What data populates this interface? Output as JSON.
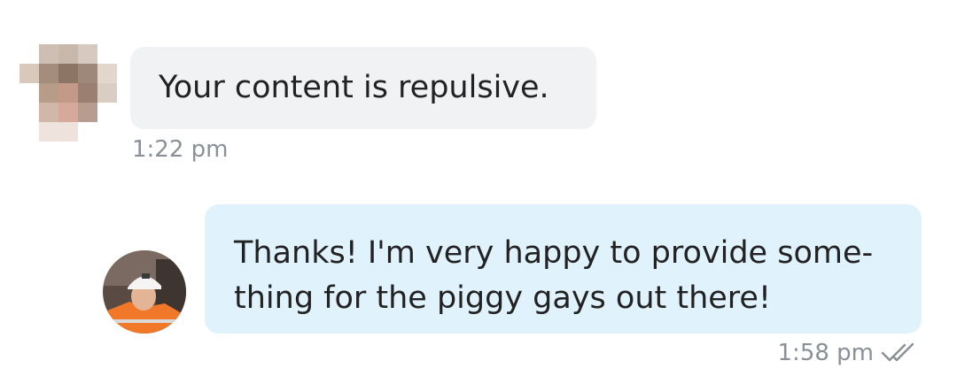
{
  "messages": [
    {
      "direction": "incoming",
      "text": "Your content is repulsive.",
      "time": "1:22 pm"
    },
    {
      "direction": "outgoing",
      "lines": [
        "Thanks! I'm very happy to provide some-",
        "thing for the piggy gays out there!"
      ],
      "time": "1:58 pm",
      "status_icon": "double-check-icon"
    }
  ],
  "colors": {
    "incoming_bubble": "#f1f2f4",
    "outgoing_bubble": "#e0f2fc",
    "text": "#222222",
    "timestamp": "#8a9097"
  }
}
